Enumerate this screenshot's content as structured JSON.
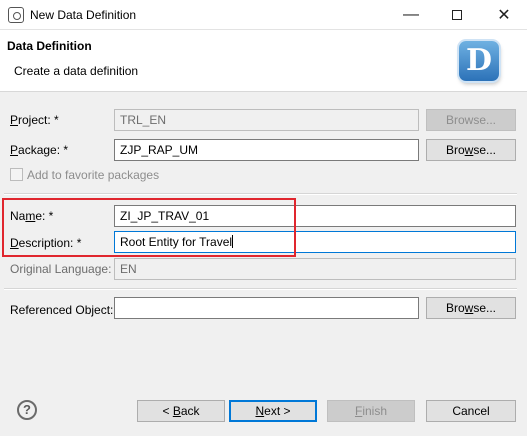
{
  "window": {
    "title": "New Data Definition",
    "minimize_glyph": "—",
    "close_glyph": "✕"
  },
  "header": {
    "title": "Data Definition",
    "subtitle": "Create a data definition",
    "icon_letter": "D",
    "icon_name": "data-definition-icon"
  },
  "form": {
    "project": {
      "mnemonic": "P",
      "rest": "roject: *",
      "value": "TRL_EN",
      "browse": "Browse...",
      "browse_enabled": false
    },
    "package": {
      "mnemonic": "P",
      "rest": "ackage: *",
      "value": "ZJP_RAP_UM",
      "browse_mnemonic": "w",
      "browse_pre": "Bro",
      "browse_post": "se...",
      "browse_enabled": true
    },
    "favorite": {
      "pre": "Add to fa",
      "mnemonic": "v",
      "post": "orite packages",
      "checked": false,
      "enabled": false
    },
    "name": {
      "pre": "Na",
      "mnemonic": "m",
      "post": "e: *",
      "value": "ZI_JP_TRAV_01"
    },
    "description": {
      "mnemonic": "D",
      "rest": "escription: *",
      "value": "Root Entity for Travel"
    },
    "original_language": {
      "label": "Original Language:",
      "value": "EN"
    },
    "referenced_object": {
      "label": "Referenced Object:",
      "value": "",
      "browse_mnemonic": "w",
      "browse_pre": "Bro",
      "browse_post": "se..."
    }
  },
  "footer": {
    "help_glyph": "?",
    "back": {
      "pre": "< ",
      "mnemonic": "B",
      "post": "ack"
    },
    "next": {
      "mnemonic": "N",
      "post": "ext >"
    },
    "finish": {
      "mnemonic": "F",
      "post": "inish"
    },
    "cancel": "Cancel"
  },
  "colors": {
    "highlight": "#e0262e",
    "focus": "#0078d7",
    "brand": "#2c72b8"
  }
}
